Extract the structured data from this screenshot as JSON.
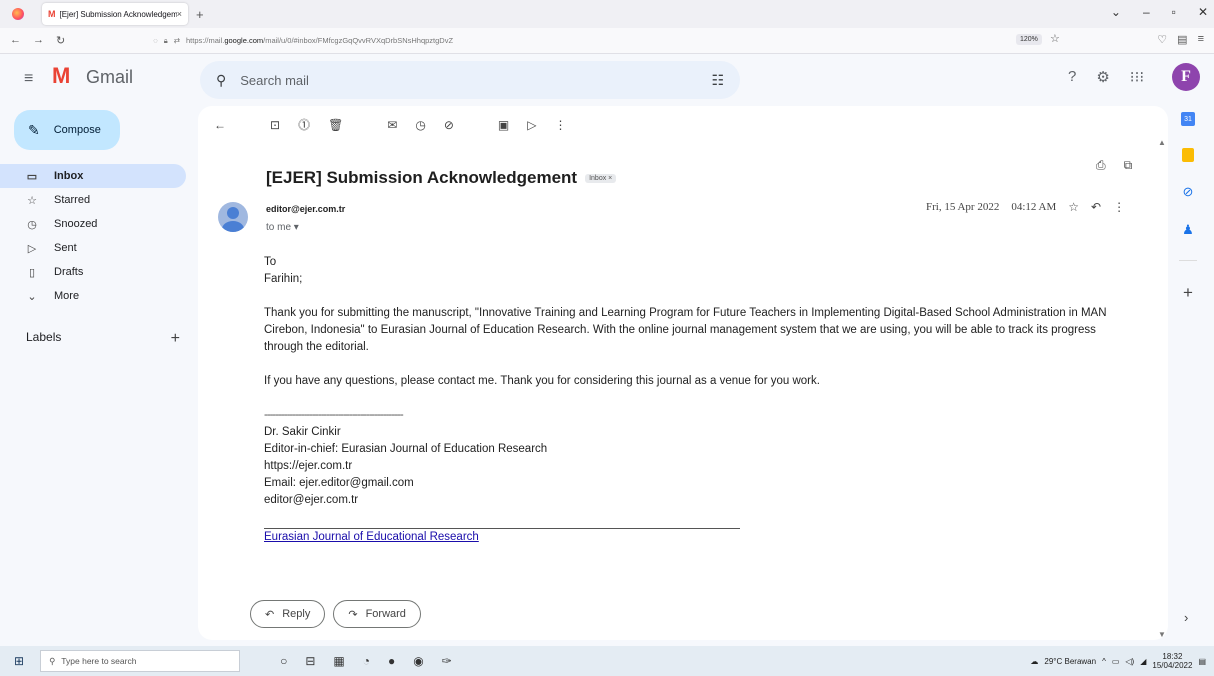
{
  "browser": {
    "tab_title": "[Ejer] Submission Acknowledgeme",
    "tab_close": "×",
    "new_tab": "+",
    "url_prefix": "https://mail.",
    "url_host": "google.com",
    "url_rest": "/mail/u/0/#inbox/FMfcgzGqQvvRVXqDrbSNsHhqpztgDvZ",
    "zoom": "120%"
  },
  "gmail": {
    "brand": "Gmail",
    "search_placeholder": "Search mail",
    "avatar_letter": "F",
    "compose_label": "Compose",
    "sidebar": {
      "items": [
        {
          "label": "Inbox",
          "icon": "inbox-icon"
        },
        {
          "label": "Starred",
          "icon": "star-icon"
        },
        {
          "label": "Snoozed",
          "icon": "clock-icon"
        },
        {
          "label": "Sent",
          "icon": "send-icon"
        },
        {
          "label": "Drafts",
          "icon": "draft-icon"
        },
        {
          "label": "More",
          "icon": "chevron-down-icon"
        }
      ],
      "labels_heading": "Labels",
      "labels_add": "+"
    }
  },
  "email": {
    "subject": "[EJER] Submission Acknowledgement",
    "chip": "Inbox ×",
    "from": "editor@ejer.com.tr",
    "to": "to me ▾",
    "date": "Fri, 15 Apr 2022",
    "time": "04:12 AM",
    "body": {
      "greeting_1": "To",
      "greeting_2": "Farihin;",
      "para_1_line_1": "Thank you for submitting the manuscript, \"Innovative Training and Learning Program for Future Teachers in Implementing Digital-Based School Administration in MAN",
      "para_1_line_2": "Cirebon, Indonesia\" to Eurasian Journal of Education Research. With the online journal management system that we are using, you will be able to track its progress",
      "para_1_line_3": "through the editorial.",
      "para_2": "If you have any questions, please contact me. Thank you for considering this journal as a venue for you work.",
      "divider": "-------------------------------------------------",
      "sig_name": "Dr. Sakir Cinkir",
      "sig_role": "Editor-in-chief: Eurasian Journal of Education Research",
      "sig_url": "https://ejer.com.tr",
      "sig_email": "Email: ejer.editor@gmail.com",
      "sig_email2": "editor@ejer.com.tr",
      "footer_link": "Eurasian Journal of Educational Research"
    },
    "reply_label": "Reply",
    "forward_label": "Forward"
  },
  "taskbar": {
    "search_placeholder": "Type here to search",
    "weather": "29°C  Berawan",
    "time": "18:32",
    "date": "15/04/2022"
  }
}
